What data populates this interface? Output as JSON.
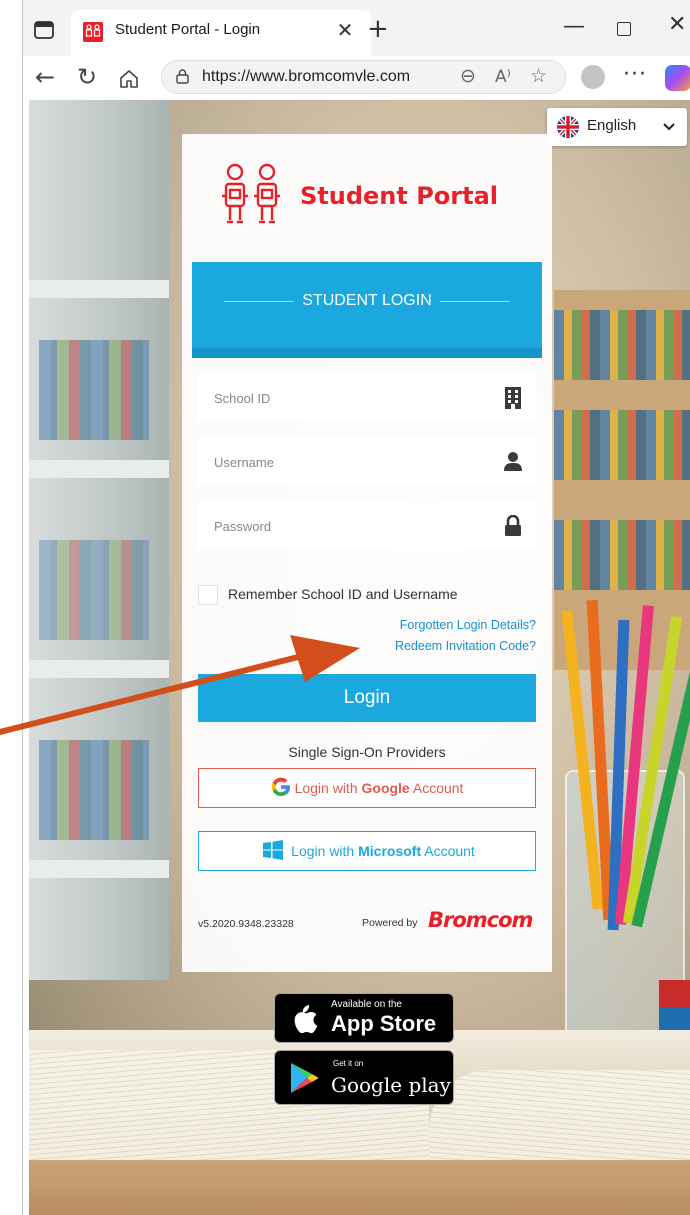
{
  "browser": {
    "tab_title": "Student Portal - Login",
    "url": "https://www.bromcomvle.com"
  },
  "language": {
    "selected": "English"
  },
  "brand": {
    "title": "Student Portal",
    "color": "#e8202a"
  },
  "login": {
    "header": "STUDENT LOGIN",
    "school_id_placeholder": "School ID",
    "username_placeholder": "Username",
    "password_placeholder": "Password",
    "remember_label": "Remember School ID and Username",
    "forgotten_link": "Forgotten Login Details?",
    "redeem_link": "Redeem Invitation Code?",
    "login_button": "Login",
    "accent_color": "#1aa8de"
  },
  "sso": {
    "label": "Single Sign-On Providers",
    "google": {
      "prefix": "Login with ",
      "brand": "Google",
      "suffix": " Account"
    },
    "microsoft": {
      "prefix": "Login with ",
      "brand": "Microsoft",
      "suffix": " Account"
    }
  },
  "footer": {
    "version": "v5.2020.9348.23328",
    "powered_by": "Powered by",
    "vendor": "Bromcom"
  },
  "stores": {
    "apple": {
      "small": "Available on the",
      "big": "App Store"
    },
    "google": {
      "small": "Get it on",
      "big": "Google play"
    }
  },
  "icons": [
    "sidebar-icon",
    "favicon",
    "close-icon",
    "new-tab-icon",
    "minimize-icon",
    "maximize-icon",
    "window-close-icon",
    "back-icon",
    "reload-icon",
    "home-icon",
    "site-info-icon",
    "zoom-icon",
    "read-aloud-icon",
    "favorite-icon",
    "profile-icon",
    "more-icon",
    "copilot-icon",
    "uk-flag-icon",
    "chevron-down-icon",
    "building-icon",
    "user-icon",
    "lock-icon",
    "google-icon",
    "windows-icon",
    "apple-icon",
    "google-play-icon"
  ]
}
